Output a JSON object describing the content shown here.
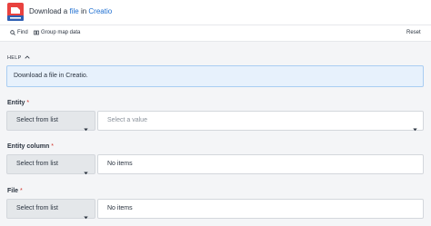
{
  "header": {
    "title_prefix": "Download a ",
    "title_link_file": "file",
    "title_mid": " in ",
    "title_link_app": "Creatio",
    "logo_icon": "creatio-logo-icon"
  },
  "toolbar": {
    "find_label": "Find",
    "group_map_label": "Group map data",
    "reset_label": "Reset"
  },
  "help": {
    "header_label": "HELP",
    "text": "Download a file in Creatio."
  },
  "fields": {
    "entity": {
      "label": "Entity",
      "required_mark": "*",
      "mode": "Select from list",
      "placeholder": "Select a value"
    },
    "entity_column": {
      "label": "Entity column",
      "required_mark": "*",
      "mode": "Select from list",
      "value": "No items"
    },
    "file": {
      "label": "File",
      "required_mark": "*",
      "mode": "Select from list",
      "value": "No items"
    }
  },
  "colors": {
    "accent_link": "#1f6fd1",
    "help_bg": "#e7f1fc",
    "required": "#d0342c",
    "logo": "#e8423f"
  }
}
